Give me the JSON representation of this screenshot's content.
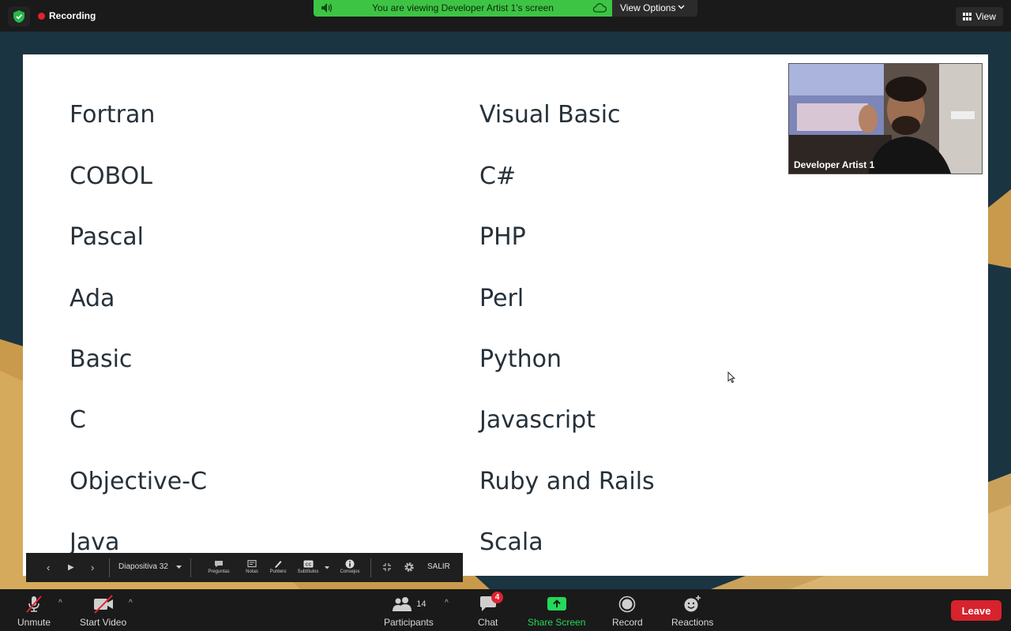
{
  "topbar": {
    "recording_label": "Recording",
    "banner_text": "You are viewing Developer Artist 1's screen",
    "view_options_label": "View Options",
    "view_label": "View"
  },
  "slide": {
    "left_column": [
      "Fortran",
      "COBOL",
      "Pascal",
      "Ada",
      "Basic",
      "C",
      "Objective-C",
      "Java"
    ],
    "right_column": [
      "Visual Basic",
      "C#",
      "PHP",
      "Perl",
      "Python",
      "Javascript",
      "Ruby and Rails",
      "Scala"
    ]
  },
  "video_tile": {
    "participant_name": "Developer Artist 1"
  },
  "slideshow_toolbar": {
    "slide_label": "Diapositiva 32",
    "tools": [
      "Preguntas",
      "Notas",
      "Puntero",
      "Subtítulos",
      "Consejos"
    ],
    "exit_label": "SALIR"
  },
  "bottombar": {
    "unmute_label": "Unmute",
    "start_video_label": "Start Video",
    "participants_count": "14",
    "participants_label": "Participants",
    "chat_label": "Chat",
    "chat_badge": "4",
    "share_screen_label": "Share Screen",
    "record_label": "Record",
    "reactions_label": "Reactions",
    "leave_label": "Leave"
  },
  "colors": {
    "banner_green": "#3ec444",
    "leave_red": "#d6232d",
    "share_green": "#23d959",
    "recording_red": "#e0232f"
  }
}
